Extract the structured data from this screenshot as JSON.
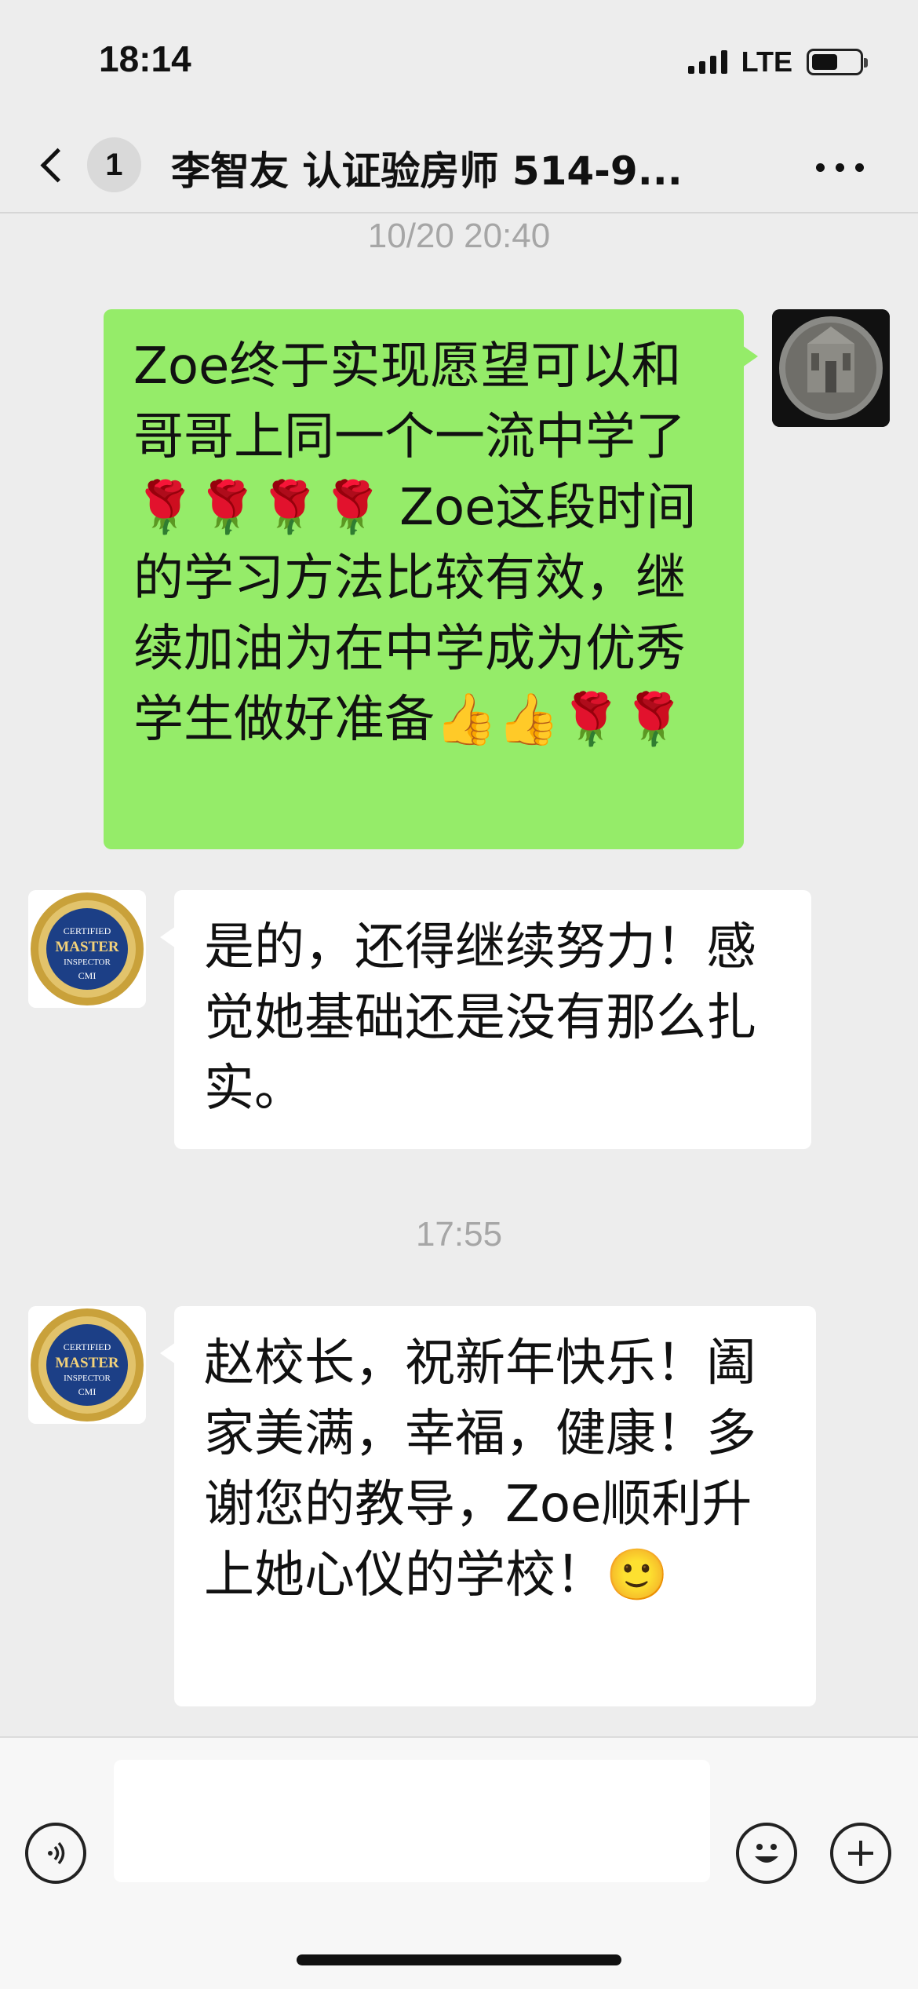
{
  "status_bar": {
    "time": "18:14",
    "network": "LTE"
  },
  "nav": {
    "unread_count": "1",
    "title": "李智友 认证验房师 514-9..."
  },
  "messages": [
    {
      "type": "timestamp",
      "text": "10/20 20:40"
    },
    {
      "type": "outgoing",
      "text": "Zoe终于实现愿望可以和哥哥上同一个一流中学了🌹🌹🌹🌹 Zoe这段时间的学习方法比较有效，继续加油为在中学成为优秀学生做好准备👍👍🌹🌹"
    },
    {
      "type": "incoming",
      "text": "是的，还得继续努力！感觉她基础还是没有那么扎实。"
    },
    {
      "type": "timestamp",
      "text": "17:55"
    },
    {
      "type": "incoming",
      "text": "赵校长，祝新年快乐！阖家美满，幸福，健康！多谢您的教导，Zoe顺利升上她心仪的学校！🙂"
    }
  ],
  "avatars": {
    "contact_badge": {
      "line1": "CERTIFIED",
      "line2": "MASTER",
      "line3": "INSPECTOR",
      "line4": "CMI"
    }
  },
  "colors": {
    "outgoing_bubble": "#95ec69",
    "incoming_bubble": "#ffffff",
    "background": "#ededed"
  },
  "icons": {
    "voice": "voice-icon",
    "emoji": "emoji-icon",
    "plus": "plus-icon",
    "back": "chevron-left-icon",
    "more": "more-icon"
  },
  "input": {
    "value": ""
  }
}
